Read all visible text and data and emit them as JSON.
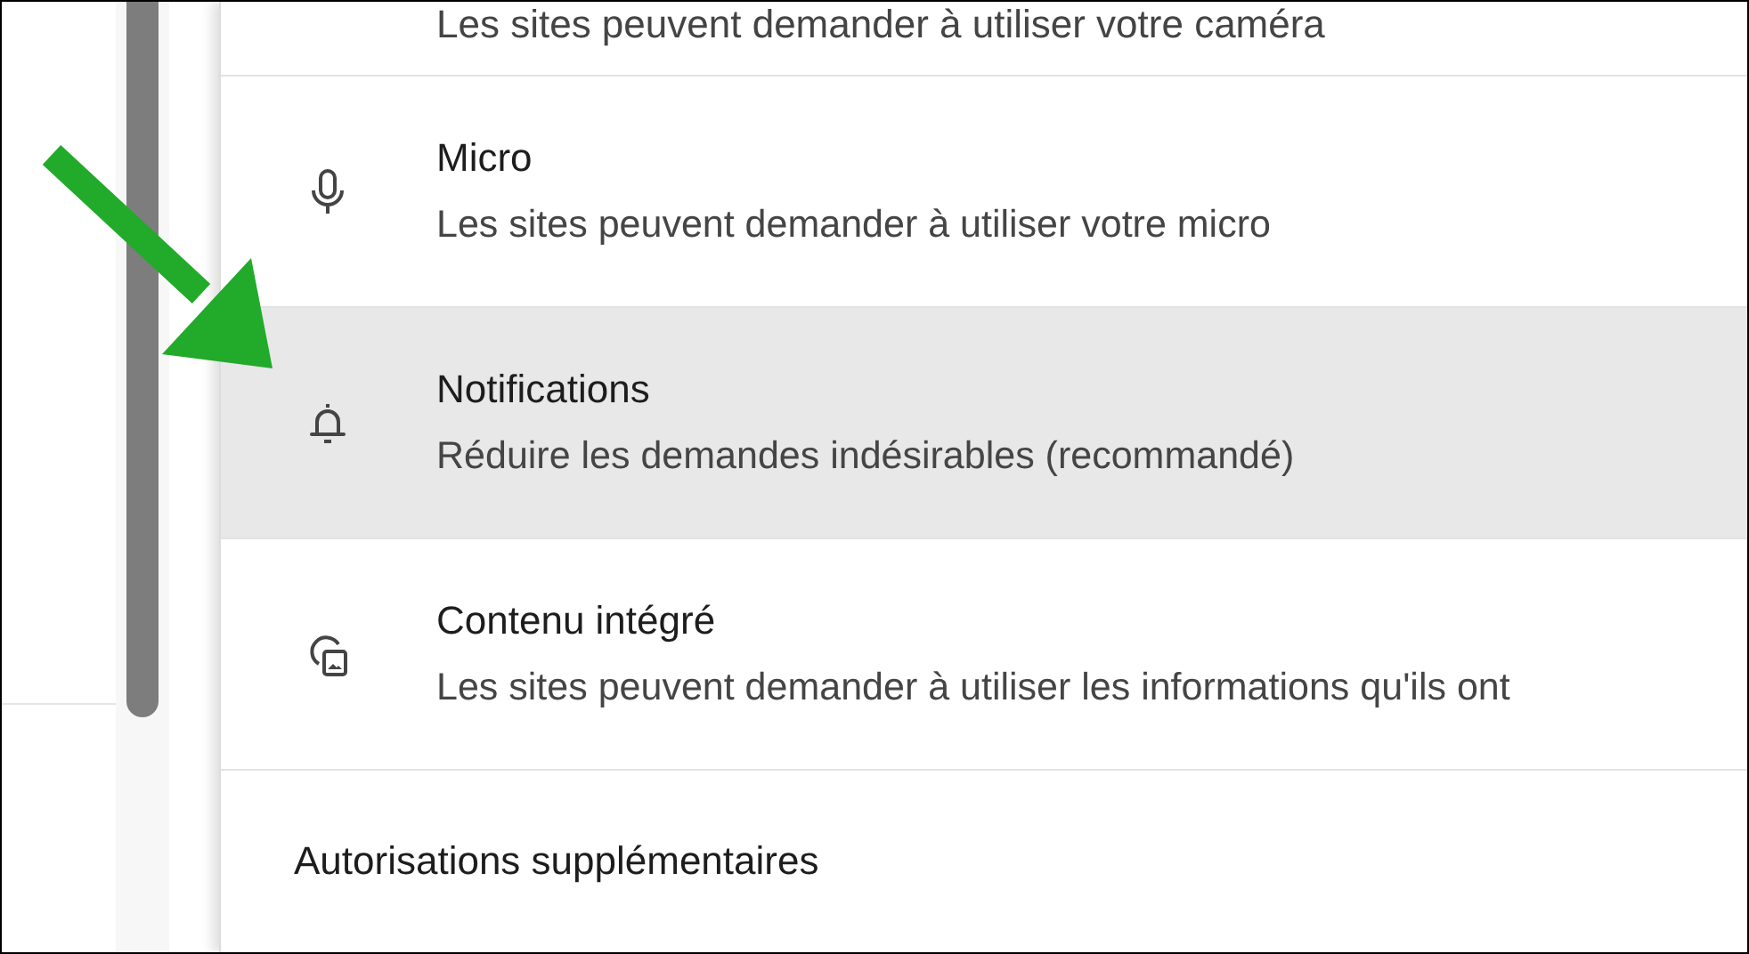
{
  "partial_row": {
    "subtitle": "Les sites peuvent demander à utiliser votre caméra"
  },
  "permissions": [
    {
      "kind": "microphone",
      "title": "Micro",
      "subtitle": "Les sites peuvent demander à utiliser votre micro",
      "selected": false
    },
    {
      "kind": "bell",
      "title": "Notifications",
      "subtitle": "Réduire les demandes indésirables (recommandé)",
      "selected": true
    },
    {
      "kind": "embedded",
      "title": "Contenu intégré",
      "subtitle": "Les sites peuvent demander à utiliser les informations qu'ils ont",
      "selected": false
    }
  ],
  "more_permissions": {
    "label": "Autorisations supplémentaires"
  }
}
